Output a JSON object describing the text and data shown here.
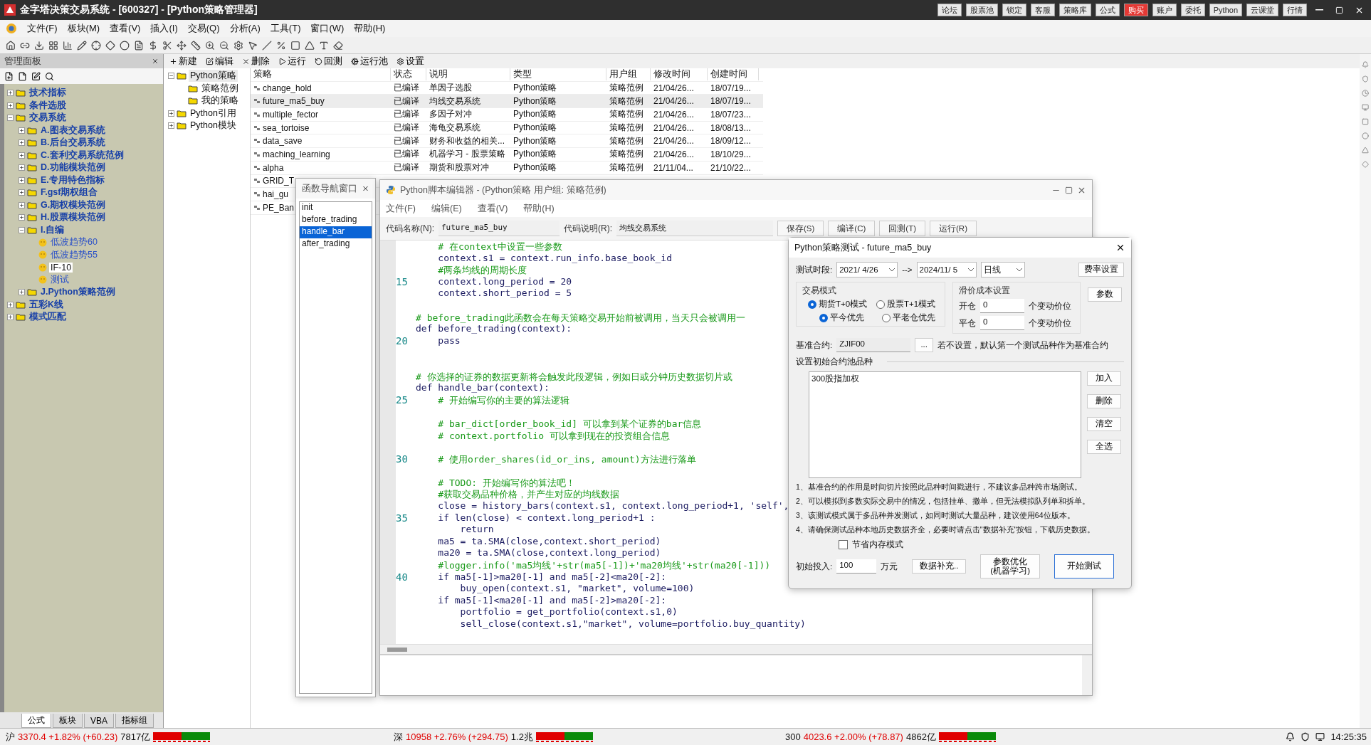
{
  "window": {
    "title": "金字塔决策交易系统 - [600327] - [Python策略管理器]",
    "quick_buttons": [
      {
        "label": "论坛",
        "highlighted": false
      },
      {
        "label": "股票池",
        "highlighted": false
      },
      {
        "label": "锁定",
        "highlighted": false
      },
      {
        "label": "客服",
        "highlighted": false
      },
      {
        "label": "策略库",
        "highlighted": false
      },
      {
        "label": "公式",
        "highlighted": false
      },
      {
        "label": "购买",
        "highlighted": true
      },
      {
        "label": "账户",
        "highlighted": false
      },
      {
        "label": "委托",
        "highlighted": false
      },
      {
        "label": "Python",
        "highlighted": false
      },
      {
        "label": "云课堂",
        "highlighted": false
      },
      {
        "label": "行情",
        "highlighted": false
      }
    ]
  },
  "menu": [
    "文件(F)",
    "板块(M)",
    "查看(V)",
    "插入(I)",
    "交易(Q)",
    "分析(A)",
    "工具(T)",
    "窗口(W)",
    "帮助(H)"
  ],
  "panel": {
    "title": "管理面板",
    "tree": [
      {
        "label": "技术指标",
        "kind": "folder",
        "expanded": false,
        "selected": false
      },
      {
        "label": "条件选股",
        "kind": "folder",
        "expanded": false,
        "selected": false
      },
      {
        "label": "交易系统",
        "kind": "folder",
        "expanded": true,
        "selected": false,
        "children": [
          {
            "label": "A.图表交易系统",
            "kind": "folder",
            "expanded": false,
            "selected": false
          },
          {
            "label": "B.后台交易系统",
            "kind": "folder",
            "expanded": false,
            "selected": false
          },
          {
            "label": "C.套利交易系统范例",
            "kind": "folder",
            "expanded": false,
            "selected": false
          },
          {
            "label": "D.功能模块范例",
            "kind": "folder",
            "expanded": false,
            "selected": false
          },
          {
            "label": "E.专用特色指标",
            "kind": "folder",
            "expanded": false,
            "selected": false
          },
          {
            "label": "F.gsf期权组合",
            "kind": "folder",
            "expanded": false,
            "selected": false
          },
          {
            "label": "G.期权模块范例",
            "kind": "folder",
            "expanded": false,
            "selected": false
          },
          {
            "label": "H.股票模块范例",
            "kind": "folder",
            "expanded": false,
            "selected": false
          },
          {
            "label": "I.自编",
            "kind": "folder",
            "expanded": true,
            "selected": false,
            "children": [
              {
                "label": "低波趋势60",
                "kind": "formula",
                "selected": false
              },
              {
                "label": "低波趋势55",
                "kind": "formula",
                "selected": false
              },
              {
                "label": "IF-10",
                "kind": "formula",
                "selected": true
              },
              {
                "label": "测试",
                "kind": "formula",
                "selected": false
              }
            ]
          },
          {
            "label": "J.Python策略范例",
            "kind": "folder",
            "expanded": false,
            "selected": false
          }
        ]
      },
      {
        "label": "五彩K线",
        "kind": "folder",
        "expanded": false,
        "selected": false
      },
      {
        "label": "模式匹配",
        "kind": "folder",
        "expanded": false,
        "selected": false
      }
    ],
    "tabs": [
      {
        "label": "公式",
        "selected": true
      },
      {
        "label": "板块",
        "selected": false
      },
      {
        "label": "VBA",
        "selected": false
      },
      {
        "label": "指标组",
        "selected": false
      }
    ]
  },
  "manager_toolbar": [
    "新建",
    "编辑",
    "删除",
    "运行",
    "回测",
    "运行池",
    "设置"
  ],
  "strategy_tree": [
    {
      "label": "Python策略",
      "expanded": true,
      "selected": true,
      "children": [
        {
          "label": "策略范例",
          "selected": false
        },
        {
          "label": "我的策略",
          "selected": false
        }
      ]
    },
    {
      "label": "Python引用",
      "expanded": false,
      "selected": false
    },
    {
      "label": "Python模块",
      "expanded": false,
      "selected": false
    }
  ],
  "table": {
    "columns": [
      "策略",
      "状态",
      "说明",
      "类型",
      "用户组",
      "修改时间",
      "创建时间"
    ],
    "rows": [
      {
        "selected": false,
        "cells": [
          "change_hold",
          "已编译",
          "单因子选股",
          "Python策略",
          "策略范例",
          "21/04/26...",
          "18/07/19..."
        ]
      },
      {
        "selected": true,
        "cells": [
          "future_ma5_buy",
          "已编译",
          "均线交易系统",
          "Python策略",
          "策略范例",
          "21/04/26...",
          "18/07/19..."
        ]
      },
      {
        "selected": false,
        "cells": [
          "multiple_fector",
          "已编译",
          "多因子对冲",
          "Python策略",
          "策略范例",
          "21/04/26...",
          "18/07/23..."
        ]
      },
      {
        "selected": false,
        "cells": [
          "sea_tortoise",
          "已编译",
          "海龟交易系统",
          "Python策略",
          "策略范例",
          "21/04/26...",
          "18/08/13..."
        ]
      },
      {
        "selected": false,
        "cells": [
          "data_save",
          "已编译",
          "财务和收益的相关...",
          "Python策略",
          "策略范例",
          "21/04/26...",
          "18/09/12..."
        ]
      },
      {
        "selected": false,
        "cells": [
          "maching_learning",
          "已编译",
          "机器学习 - 股票策略",
          "Python策略",
          "策略范例",
          "21/04/26...",
          "18/10/29..."
        ]
      },
      {
        "selected": false,
        "cells": [
          "alpha",
          "已编译",
          "期货和股票对冲",
          "Python策略",
          "策略范例",
          "21/11/04...",
          "21/10/22..."
        ]
      },
      {
        "selected": false,
        "cells": [
          "GRID_T"
        ]
      },
      {
        "selected": false,
        "cells": [
          "hai_gu"
        ]
      },
      {
        "selected": false,
        "cells": [
          "PE_Ban"
        ]
      }
    ]
  },
  "function_nav": {
    "title": "函数导航窗口",
    "items": [
      {
        "label": "init",
        "selected": false
      },
      {
        "label": "before_trading",
        "selected": false
      },
      {
        "label": "handle_bar",
        "selected": true
      },
      {
        "label": "after_trading",
        "selected": false
      }
    ]
  },
  "editor": {
    "title": "Python脚本编辑器 - (Python策略 用户组: 策略范例)",
    "menu": [
      "文件(F)",
      "编辑(E)",
      "查看(V)",
      "帮助(H)"
    ],
    "name_label": "代码名称(N):",
    "name_value": "future_ma5_buy",
    "desc_label": "代码说明(R):",
    "desc_value": "均线交易系统",
    "buttons": [
      "保存(S)",
      "编译(C)",
      "回测(T)",
      "运行(R)"
    ],
    "lines": [
      {
        "kind": "comment",
        "text": "    # 在context中设置一些参数"
      },
      {
        "kind": "code",
        "text": "    context.s1 = context.run_info.base_book_id"
      },
      {
        "kind": "comment",
        "text": "    #两条均线的周期长度"
      },
      {
        "kind": "code",
        "number": "15",
        "text": "    context.long_period = 20"
      },
      {
        "kind": "code",
        "text": "    context.short_period = 5"
      },
      {
        "kind": "blank"
      },
      {
        "kind": "comment",
        "text": "# before_trading此函数会在每天策略交易开始前被调用，当天只会被调用一"
      },
      {
        "kind": "code",
        "text": "def before_trading(context):"
      },
      {
        "kind": "code",
        "number": "20",
        "text": "    pass"
      },
      {
        "kind": "blank"
      },
      {
        "kind": "blank"
      },
      {
        "kind": "comment",
        "text": "# 你选择的证券的数据更新将会触发此段逻辑，例如日或分钟历史数据切片或"
      },
      {
        "kind": "code",
        "text": "def handle_bar(context):"
      },
      {
        "kind": "comment",
        "number": "25",
        "text": "    # 开始编写你的主要的算法逻辑"
      },
      {
        "kind": "blank"
      },
      {
        "kind": "comment",
        "text": "    # bar_dict[order_book_id] 可以拿到某个证券的bar信息"
      },
      {
        "kind": "comment",
        "text": "    # context.portfolio 可以拿到现在的投资组合信息"
      },
      {
        "kind": "blank"
      },
      {
        "kind": "comment",
        "number": "30",
        "text": "    # 使用order_shares(id_or_ins, amount)方法进行落单"
      },
      {
        "kind": "blank"
      },
      {
        "kind": "comment",
        "text": "    # TODO: 开始编写你的算法吧！"
      },
      {
        "kind": "comment",
        "text": "    #获取交易品种价格，并产生对应的均线数据"
      },
      {
        "kind": "code",
        "text": "    close = history_bars(context.s1, context.long_period+1, 'self',"
      },
      {
        "kind": "code",
        "number": "35",
        "text": "    if len(close) < context.long_period+1 :"
      },
      {
        "kind": "code",
        "text": "        return"
      },
      {
        "kind": "code",
        "text": "    ma5 = ta.SMA(close,context.short_period)"
      },
      {
        "kind": "code",
        "text": "    ma20 = ta.SMA(close,context.long_period)"
      },
      {
        "kind": "comment",
        "text": "    #logger.info('ma5均线'+str(ma5[-1])+'ma20均线'+str(ma20[-1]))"
      },
      {
        "kind": "code",
        "number": "40",
        "text": "    if ma5[-1]>ma20[-1] and ma5[-2]<ma20[-2]:"
      },
      {
        "kind": "code",
        "text": "        buy_open(context.s1, \"market\", volume=100)"
      },
      {
        "kind": "code",
        "text": "    if ma5[-1]<ma20[-1] and ma5[-2]>ma20[-2]:"
      },
      {
        "kind": "code",
        "text": "        portfolio = get_portfolio(context.s1,0)"
      },
      {
        "kind": "code",
        "text": "        sell_close(context.s1,\"market\", volume=portfolio.buy_quantity)"
      }
    ]
  },
  "test_dialog": {
    "title": "Python策略测试 - future_ma5_buy",
    "period_label": "测试时段:",
    "start_date": "2021/ 4/26",
    "arrow": "-->",
    "end_date": "2024/11/ 5",
    "interval": "日线",
    "fee_button": "费率设置",
    "mode_group": "交易模式",
    "modes": [
      {
        "label": "期货T+0模式",
        "selected": true
      },
      {
        "label": "股票T+1模式",
        "selected": false
      }
    ],
    "close_priority": [
      {
        "label": "平今优先",
        "selected": true
      },
      {
        "label": "平老仓优先",
        "selected": false
      }
    ],
    "slippage_group": "滑价成本设置",
    "slippage": [
      {
        "label": "开仓",
        "value": "0",
        "unit": "个变动价位"
      },
      {
        "label": "平仓",
        "value": "0",
        "unit": "个变动价位"
      }
    ],
    "params_button": "参数",
    "benchmark_label": "基准合约:",
    "benchmark_value": "ZJIF00",
    "browse_button": "...",
    "benchmark_hint": "若不设置，默认第一个测试品种作为基准合约",
    "pool_label": "设置初始合约池品种",
    "pool_items": [
      "300股指加权"
    ],
    "pool_buttons": [
      "加入",
      "删除",
      "清空",
      "全选"
    ],
    "notes": [
      "1、基准合约的作用是时间切片按照此品种时间戳进行，不建议多品种跨市场测试。",
      "2、可以模拟到多数实际交易中的情况，包括挂单、撤单，但无法模拟队列单和拆单。",
      "3、该测试模式属于多品种并发测试，如同时测试大量品种，建议使用64位版本。",
      "4、请确保测试品种本地历史数据齐全，必要时请点击\"数据补充\"按钮，下载历史数据。"
    ],
    "memory_mode": {
      "label": "节省内存模式",
      "checked": false
    },
    "capital_label": "初始投入:",
    "capital_value": "100",
    "capital_unit": "万元",
    "supplement_button": "数据补充..",
    "optimize_button": [
      "参数优化",
      "(机器学习)"
    ],
    "start_button": "开始测试"
  },
  "status_bar": {
    "markets": [
      {
        "label": "沪",
        "value": "3370.4 +1.82% (+60.23)",
        "amount": "7817亿"
      },
      {
        "label": "深",
        "value": "10958 +2.76% (+294.75)",
        "amount": "1.2兆"
      },
      {
        "label": "300",
        "value": "4023.6 +2.00% (+78.87)",
        "amount": "4862亿"
      }
    ],
    "time": "14:25:35"
  }
}
